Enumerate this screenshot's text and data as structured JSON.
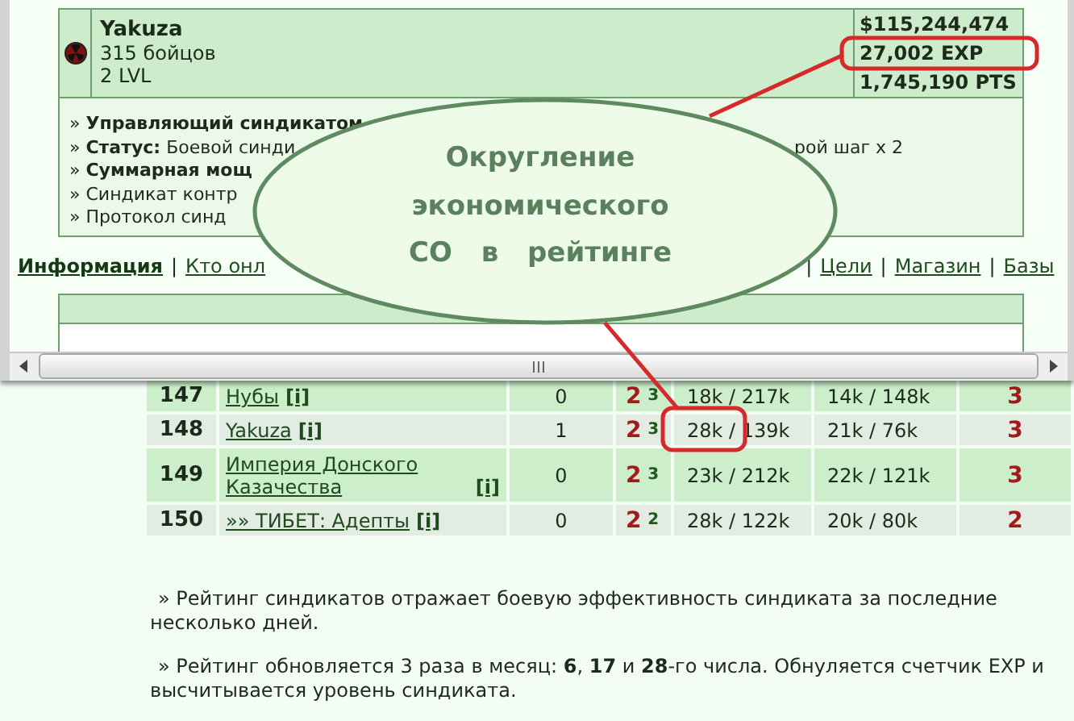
{
  "popup": {
    "clan": {
      "name": "Yakuza",
      "fighters": "315 бойцов",
      "level": "2 LVL",
      "money": "$115,244,474",
      "exp": "27,002 EXP",
      "points": "1,745,190 PTS"
    },
    "info_lines": [
      {
        "bullet": "»",
        "label": "Управляющий синдикатом"
      },
      {
        "bullet": "»",
        "label": "Статус:",
        "text": "Боевой синди",
        "tail": "рой шаг x 2"
      },
      {
        "bullet": "»",
        "label": "Суммарная мощ"
      },
      {
        "bullet": "»",
        "text": "Синдикат контр"
      },
      {
        "bullet": "»",
        "text": "Протокол синд"
      }
    ],
    "nav": {
      "separator": "|",
      "left": [
        {
          "label": "Информация",
          "selected": true
        },
        {
          "label": "Кто онл",
          "selected": false
        }
      ],
      "right": [
        {
          "label": "Цели",
          "selected": false
        },
        {
          "label": "Магазин",
          "selected": false
        },
        {
          "label": "Базы",
          "selected": false
        }
      ]
    }
  },
  "ranking": {
    "rows": [
      {
        "rank": "147",
        "name": "Нубы",
        "info": "[i]",
        "column_3": "0",
        "level": "2",
        "sublevel": "3",
        "column_5": "18k / 217k",
        "column_6": "14k / 148k",
        "column_7": "3"
      },
      {
        "rank": "148",
        "name": "Yakuza",
        "info": "[i]",
        "column_3": "1",
        "level": "2",
        "sublevel": "3",
        "column_5": "28k / 139k",
        "column_6": "21k / 76k",
        "column_7": "3"
      },
      {
        "rank": "149",
        "name": "Империя Донского Казачества",
        "info": "[i]",
        "column_3": "0",
        "level": "2",
        "sublevel": "3",
        "column_5": "23k / 212k",
        "column_6": "22k / 121k",
        "column_7": "3"
      },
      {
        "rank": "150",
        "name": "»» ТИБЕТ: Адепты",
        "info": "[i]",
        "column_3": "0",
        "level": "2",
        "sublevel": "2",
        "column_5": "28k / 122k",
        "column_6": "20k / 80k",
        "column_7": "2"
      }
    ]
  },
  "notes": [
    "» Рейтинг синдикатов отражает боевую эффективность синдиката за последние несколько дней.",
    "» Рейтинг обновляется 3 раза в месяц: **6**, **17** и **28**-го числа. Обнуляется счетчик EXP и высчитывается уровень синдиката."
  ],
  "callout": {
    "lines": [
      "Округление",
      "экономического",
      "СО в рейтинге"
    ]
  }
}
